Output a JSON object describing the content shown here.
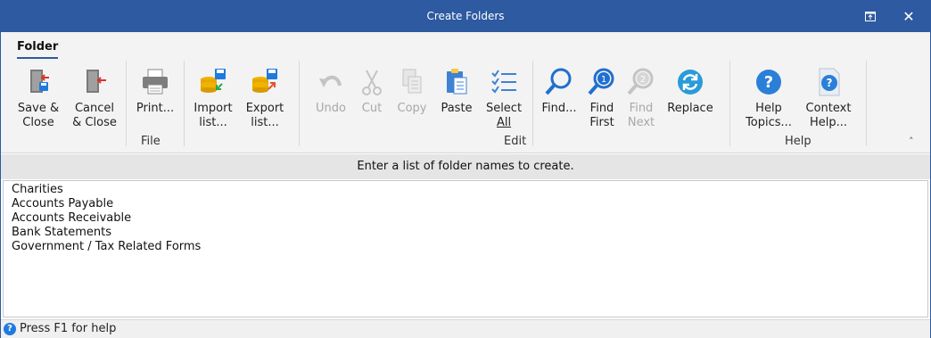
{
  "window": {
    "title": "Create Folders",
    "restore_label": "⧉",
    "close_label": "✕"
  },
  "ribbon": {
    "tab": "Folder",
    "groups": {
      "file": "File",
      "edit": "Edit",
      "help": "Help"
    },
    "buttons": {
      "save_close_line1": "Save &",
      "save_close_line2": "Close",
      "cancel_close_line1": "Cancel",
      "cancel_close_line2": "& Close",
      "print": "Print...",
      "import_line1": "Import",
      "import_line2": "list...",
      "export_line1": "Export",
      "export_line2": "list...",
      "undo": "Undo",
      "cut": "Cut",
      "copy": "Copy",
      "paste": "Paste",
      "select_all_line1": "Select",
      "select_all_line2": "All",
      "find": "Find...",
      "find_first_line1": "Find",
      "find_first_line2": "First",
      "find_next_line1": "Find",
      "find_next_line2": "Next",
      "replace": "Replace",
      "help_topics_line1": "Help",
      "help_topics_line2": "Topics...",
      "context_help_line1": "Context",
      "context_help_line2": "Help..."
    },
    "collapse_label": "˄"
  },
  "hint": "Enter a list of folder names to create.",
  "editor": {
    "lines": [
      "Charities",
      "Accounts Payable",
      "Accounts Receivable",
      "Bank Statements",
      "Government / Tax Related Forms"
    ]
  },
  "status": {
    "text": "Press F1 for help",
    "icon": "?"
  }
}
